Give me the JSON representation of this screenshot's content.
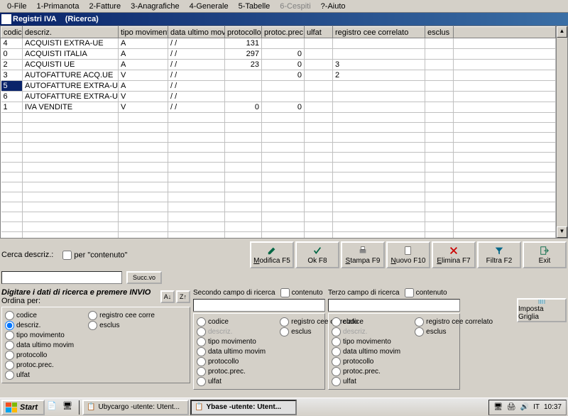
{
  "menu": [
    "0-File",
    "1-Primanota",
    "2-Fatture",
    "3-Anagrafiche",
    "4-Generale",
    "5-Tabelle",
    "6-Cespiti",
    "?-Aiuto"
  ],
  "menu_disabled_idx": 6,
  "title": {
    "main": "Registri IVA",
    "sub": "(Ricerca)"
  },
  "cols": [
    "codice",
    "descriz.",
    "tipo movimento",
    "data ultimo movim",
    "protocollo",
    "protoc.prec.",
    "ulfat",
    "registro cee correlato",
    "esclus"
  ],
  "rows": [
    {
      "codice": "4",
      "descriz": "ACQUISTI EXTRA-UE",
      "tipo": "A",
      "data": "/ /",
      "proto": "131",
      "pprec": "",
      "ulfat": "",
      "reg": "",
      "esc": ""
    },
    {
      "codice": "0",
      "descriz": "ACQUISTI ITALIA",
      "tipo": "A",
      "data": "/ /",
      "proto": "297",
      "pprec": "0",
      "ulfat": "",
      "reg": "",
      "esc": ""
    },
    {
      "codice": "2",
      "descriz": "ACQUISTI UE",
      "tipo": "A",
      "data": "/ /",
      "proto": "23",
      "pprec": "0",
      "ulfat": "",
      "reg": "3",
      "esc": ""
    },
    {
      "codice": "3",
      "descriz": "AUTOFATTURE ACQ.UE",
      "tipo": "V",
      "data": "/ /",
      "proto": "",
      "pprec": "0",
      "ulfat": "",
      "reg": "2",
      "esc": ""
    },
    {
      "codice": "5",
      "descriz": "AUTOFATTURE EXTRA-UE ACQ.",
      "tipo": "A",
      "data": "/ /",
      "proto": "",
      "pprec": "",
      "ulfat": "",
      "reg": "",
      "esc": ""
    },
    {
      "codice": "6",
      "descriz": "AUTOFATTURE EXTRA-UE VEN.",
      "tipo": "V",
      "data": "/ /",
      "proto": "",
      "pprec": "",
      "ulfat": "",
      "reg": "",
      "esc": ""
    },
    {
      "codice": "1",
      "descriz": "IVA VENDITE",
      "tipo": "V",
      "data": "/ /",
      "proto": "0",
      "pprec": "0",
      "ulfat": "",
      "reg": "",
      "esc": ""
    }
  ],
  "selected_row_idx": 4,
  "search": {
    "label": "Cerca descriz.:",
    "per_contenuto": "per \"contenuto\"",
    "succvo": "Succ.vo"
  },
  "hint": "Digitare i dati di ricerca e premere INVIO",
  "ordina_label": "Ordina per:",
  "sort_fields_left": [
    "codice",
    "descriz.",
    "tipo movimento",
    "data ultimo movim",
    "protocollo",
    "protoc.prec.",
    "ulfat"
  ],
  "sort_fields_right": [
    "registro cee corre",
    "esclus"
  ],
  "sort_selected": "descriz.",
  "secondo": {
    "label": "Secondo campo di ricerca",
    "contenuto": "contenuto"
  },
  "terzo": {
    "label": "Terzo campo di ricerca",
    "contenuto": "contenuto"
  },
  "sub_fields_left": [
    "codice",
    "descriz.",
    "tipo movimento",
    "data ultimo movim",
    "protocollo",
    "protoc.prec.",
    "ulfat"
  ],
  "sub_fields_right": [
    "registro cee correlato",
    "esclus"
  ],
  "buttons": {
    "modifica": "Modifica F5",
    "ok": "Ok F8",
    "stampa": "Stampa F9",
    "nuovo": "Nuovo F10",
    "elimina": "Elimina F7",
    "filtra": "Filtra F2",
    "exit": "Exit",
    "imposta": "Imposta Griglia"
  },
  "taskbar": {
    "start": "Start",
    "app1": "Ubycargo -utente: Utent...",
    "app2": "Ybase -utente: Utent...",
    "lang": "IT",
    "time": "10:37"
  }
}
